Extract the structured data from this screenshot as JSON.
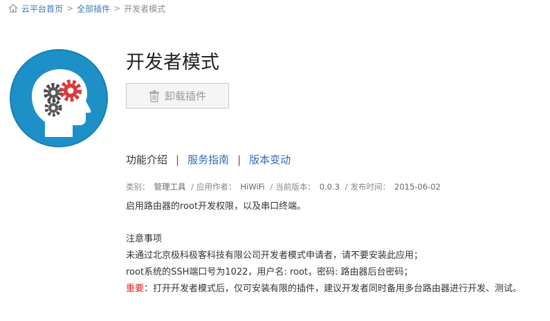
{
  "breadcrumb": {
    "home": "云平台首页",
    "sep": ">",
    "all_plugins": "全部插件",
    "current": "开发者模式"
  },
  "plugin": {
    "title": "开发者模式",
    "uninstall_label": "卸载插件",
    "icon": "head-gears-icon",
    "icon_color": "#1e90c8"
  },
  "tabs": [
    {
      "label": "功能介绍"
    },
    {
      "label": "服务指南"
    },
    {
      "label": "版本变动"
    }
  ],
  "tab_divider": "|",
  "meta": {
    "category_label": "类别：",
    "category": "管理工具",
    "author_label": "应用作者：",
    "author": "HiWiFi",
    "version_label": "当前版本：",
    "version": "0.0.3",
    "date_label": "发布时间：",
    "date": "2015-06-02",
    "slash": "/"
  },
  "description": "启用路由器的root开发权限，以及串口终端。",
  "notes": {
    "heading": "注意事项",
    "line1": "未通过北京极科极客科技有限公司开发者模式申请者，请不要安装此应用；",
    "line2": "root系统的SSH端口号为1022，用户名: root，密码: 路由器后台密码；",
    "important_label": "重要",
    "line3": "：打开开发者模式后，仅可安装有限的插件，建议开发者同时备用多台路由器进行开发、测试。"
  },
  "colors": {
    "link": "#2d6db5",
    "important": "#e02020",
    "icon_bg": "#1e90c8"
  }
}
